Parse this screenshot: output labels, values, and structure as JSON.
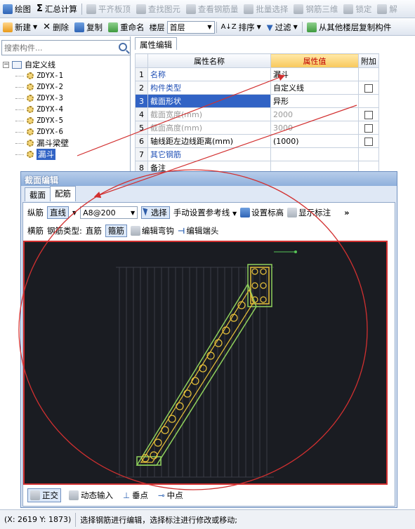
{
  "toolbar1": {
    "draw": "绘图",
    "sum": "汇总计算",
    "level_top": "平齐板顶",
    "find": "查找图元",
    "view_rebar": "查看钢筋量",
    "batch_select": "批量选择",
    "rebar_3d": "钢筋三维",
    "lock": "锁定",
    "unlock": "解"
  },
  "toolbar2": {
    "new": "新建",
    "delete": "删除",
    "copy": "复制",
    "rename": "重命名",
    "floor_label": "楼层",
    "floor_value": "首层",
    "sort": "排序",
    "filter": "过滤",
    "copy_from_floor": "从其他楼层复制构件"
  },
  "left_panel": {
    "search_placeholder": "搜索构件...",
    "root": "自定义线",
    "items": [
      "ZDYX-1",
      "ZDYX-2",
      "ZDYX-3",
      "ZDYX-4",
      "ZDYX-5",
      "ZDYX-6",
      "漏斗梁壁",
      "漏斗"
    ],
    "selected_index": 7
  },
  "prop_panel": {
    "tab": "属性编辑",
    "headers": {
      "name": "属性名称",
      "value": "属性值",
      "extra": "附加"
    },
    "rows": [
      {
        "num": "1",
        "name": "名称",
        "value": "漏斗"
      },
      {
        "num": "2",
        "name": "构件类型",
        "value": "自定义线"
      },
      {
        "num": "3",
        "name": "截面形状",
        "value": "异形"
      },
      {
        "num": "4",
        "name": "截面宽度(mm)",
        "value": "2000"
      },
      {
        "num": "5",
        "name": "截面高度(mm)",
        "value": "3000"
      },
      {
        "num": "6",
        "name": "轴线距左边线距离(mm)",
        "value": "(1000)"
      },
      {
        "num": "7",
        "name": "其它钢筋",
        "value": ""
      },
      {
        "num": "8",
        "name": "备注",
        "value": ""
      }
    ]
  },
  "dialog": {
    "title": "截面编辑",
    "tabs": [
      "截面",
      "配筋"
    ],
    "active_tab": 1,
    "row1": {
      "label_long": "纵筋",
      "line_type": "直线",
      "rebar_spec": "A8@200",
      "select": "选择",
      "manual_ref": "手动设置参考线",
      "set_elev": "设置标高",
      "show_dim": "显示标注"
    },
    "row2": {
      "label_trans": "横筋",
      "rebar_type_label": "钢筋类型:",
      "straight": "直筋",
      "stirrup": "箍筋",
      "edit_hook": "编辑弯钩",
      "edit_end": "编辑端头"
    },
    "status": {
      "ortho": "正交",
      "dynamic": "动态输入",
      "perp": "垂点",
      "mid": "中点"
    }
  },
  "statusbar": {
    "coords": "(X: 2619 Y: 1873)",
    "message": "选择钢筋进行编辑，选择标注进行修改或移动;"
  },
  "colors": {
    "selection_blue": "#3163c5",
    "annotation_red": "#d23030",
    "canvas_bg": "#1a1c22",
    "rebar_yellow": "#e8c23a",
    "section_outline": "#8fd05c",
    "value_header": "#f8c85b"
  }
}
